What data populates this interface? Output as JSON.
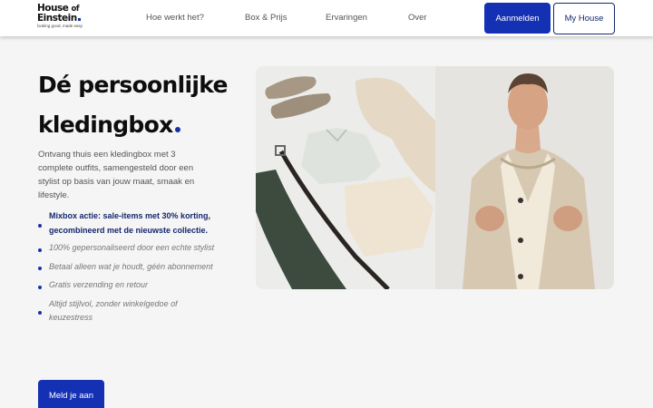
{
  "logo": {
    "line1": "House",
    "line1_small": "of",
    "line2": "Einstein",
    "tagline": "looking good, made easy"
  },
  "nav": {
    "items": [
      {
        "label": "Hoe werkt het?"
      },
      {
        "label": "Box & Prijs"
      },
      {
        "label": "Ervaringen"
      },
      {
        "label": "Over"
      }
    ],
    "login_label": "Aanmelden",
    "account_label": "My House"
  },
  "hero": {
    "title_line1": "Dé persoonlijke",
    "title_line2": "kledingbox",
    "intro": "Ontvang thuis een kledingbox met 3 complete outfits, samengesteld door een stylist op basis van jouw maat, smaak en lifestyle.",
    "usps": [
      {
        "text": "Mixbox actie: sale-items met 30% korting, gecombineerd met de nieuwste collectie."
      },
      {
        "text": "100% gepersonaliseerd door een echte stylist"
      },
      {
        "text": "Betaal alleen wat je houdt, géén abonnement"
      },
      {
        "text": "Gratis verzending en retour"
      },
      {
        "text": "Altijd stijlvol, zonder winkelgedoe of keuzestress"
      }
    ],
    "cta_label": "Meld je aan",
    "image_alt": "Flatlay of clothing items next to a man in a beige coat"
  },
  "colors": {
    "brand_blue": "#1430b3",
    "navy": "#14286b",
    "background": "#f5f5f5"
  }
}
